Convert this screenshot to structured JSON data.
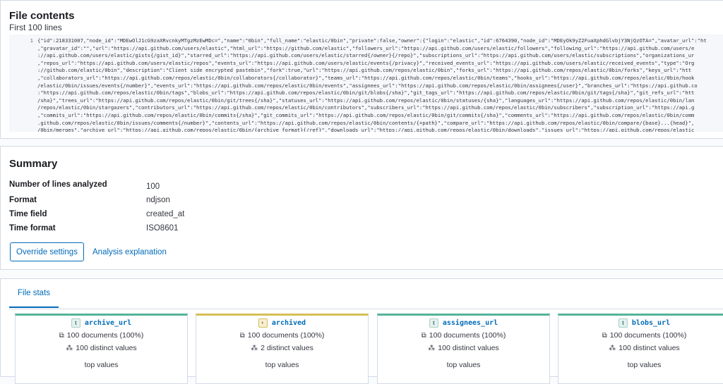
{
  "file_contents": {
    "title": "File contents",
    "subtitle": "First 100 lines",
    "line_number": "1",
    "lines": [
      "{\"id\":218331007,\"node_id\":\"MDEwOlJ1cG9zaXRvcnkyMTgzMzEwMDc=\",\"name\":\"0bin\",\"full_name\":\"elastic/0bin\",\"private\":false,\"owner\":{\"login\":\"elastic\",\"id\":6764390,\"node_id\":\"MDEyOk9yZ2FuaXphdGlvbjY3NjQzOTA=\",\"avatar_url\":\"ht",
      ",\"gravatar_id\":\"\",\"url\":\"https://api.github.com/users/elastic\",\"html_url\":\"https://github.com/elastic\",\"followers_url\":\"https://api.github.com/users/elastic/followers\",\"following_url\":\"https://api.github.com/users/e",
      "://api.github.com/users/elastic/gists{/gist_id}\",\"starred_url\":\"https://api.github.com/users/elastic/starred{/owner}{/repo}\",\"subscriptions_url\":\"https://api.github.com/users/elastic/subscriptions\",\"organizations_ur",
      ",\"repos_url\":\"https://api.github.com/users/elastic/repos\",\"events_url\":\"https://api.github.com/users/elastic/events{/privacy}\",\"received_events_url\":\"https://api.github.com/users/elastic/received_events\",\"type\":\"Org",
      "://github.com/elastic/0bin\",\"description\":\"Client side encrypted pastebin\",\"fork\":true,\"url\":\"https://api.github.com/repos/elastic/0bin\",\"forks_url\":\"https://api.github.com/repos/elastic/0bin/forks\",\"keys_url\":\"htt",
      ",\"collaborators_url\":\"https://api.github.com/repos/elastic/0bin/collaborators{/collaborator}\",\"teams_url\":\"https://api.github.com/repos/elastic/0bin/teams\",\"hooks_url\":\"https://api.github.com/repos/elastic/0bin/hook",
      "/elastic/0bin/issues/events{/number}\",\"events_url\":\"https://api.github.com/repos/elastic/0bin/events\",\"assignees_url\":\"https://api.github.com/repos/elastic/0bin/assignees{/user}\",\"branches_url\":\"https://api.github.co",
      ":\"https://api.github.com/repos/elastic/0bin/tags\",\"blobs_url\":\"https://api.github.com/repos/elastic/0bin/git/blobs{/sha}\",\"git_tags_url\":\"https://api.github.com/repos/elastic/0bin/git/tags{/sha}\",\"git_refs_url\":\"htt",
      "/sha}\",\"trees_url\":\"https://api.github.com/repos/elastic/0bin/git/trees{/sha}\",\"statuses_url\":\"https://api.github.com/repos/elastic/0bin/statuses/{sha}\",\"languages_url\":\"https://api.github.com/repos/elastic/0bin/lan",
      "/repos/elastic/0bin/stargazers\",\"contributors_url\":\"https://api.github.com/repos/elastic/0bin/contributors\",\"subscribers_url\":\"https://api.github.com/repos/elastic/0bin/subscribers\",\"subscription_url\":\"https://api.g",
      ",\"commits_url\":\"https://api.github.com/repos/elastic/0bin/commits{/sha}\",\"git_commits_url\":\"https://api.github.com/repos/elastic/0bin/git/commits{/sha}\",\"comments_url\":\"https://api.github.com/repos/elastic/0bin/comm",
      ".github.com/repos/elastic/0bin/issues/comments{/number}\",\"contents_url\":\"https://api.github.com/repos/elastic/0bin/contents/{+path}\",\"compare_url\":\"https://api.github.com/repos/elastic/0bin/compare/{base}...{head}\",",
      "/0bin/merges\",\"archive_url\":\"https://api.github.com/repos/elastic/0bin/{archive_format}{/ref}\",\"downloads_url\":\"https://api.github.com/repos/elastic/0bin/downloads\",\"issues_url\":\"https://api.github.com/repos/elastic",
      ".github.com/repos/elastic/0bin/pulls{/number}\",\"milestones_url\":\"https://api.github.com/repos/elastic/0bin/milestones{/number}\",\"notifications_url\":\"https://api.github.com/repos/elastic/0bin/notifications{?since,all"
    ]
  },
  "summary": {
    "title": "Summary",
    "rows": [
      {
        "label": "Number of lines analyzed",
        "value": "100"
      },
      {
        "label": "Format",
        "value": "ndjson"
      },
      {
        "label": "Time field",
        "value": "created_at"
      },
      {
        "label": "Time format",
        "value": "ISO8601"
      }
    ],
    "override_label": "Override settings",
    "explanation_label": "Analysis explanation"
  },
  "file_stats": {
    "tab_label": "File stats",
    "cards": [
      {
        "name": "archive_url",
        "type": "text",
        "type_glyph": "t",
        "documents": "100 documents (100%)",
        "distinct": "100 distinct values",
        "top_values": "top values"
      },
      {
        "name": "archived",
        "type": "boolean",
        "type_glyph": "◐",
        "documents": "100 documents (100%)",
        "distinct": "2 distinct values",
        "top_values": "top values"
      },
      {
        "name": "assignees_url",
        "type": "text",
        "type_glyph": "t",
        "documents": "100 documents (100%)",
        "distinct": "100 distinct values",
        "top_values": "top values"
      },
      {
        "name": "blobs_url",
        "type": "text",
        "type_glyph": "t",
        "documents": "100 documents (100%)",
        "distinct": "100 distinct values",
        "top_values": "top values"
      }
    ]
  },
  "colors": {
    "link": "#006bb8",
    "text_type": "#54b399",
    "boolean_type": "#d6bf57"
  }
}
